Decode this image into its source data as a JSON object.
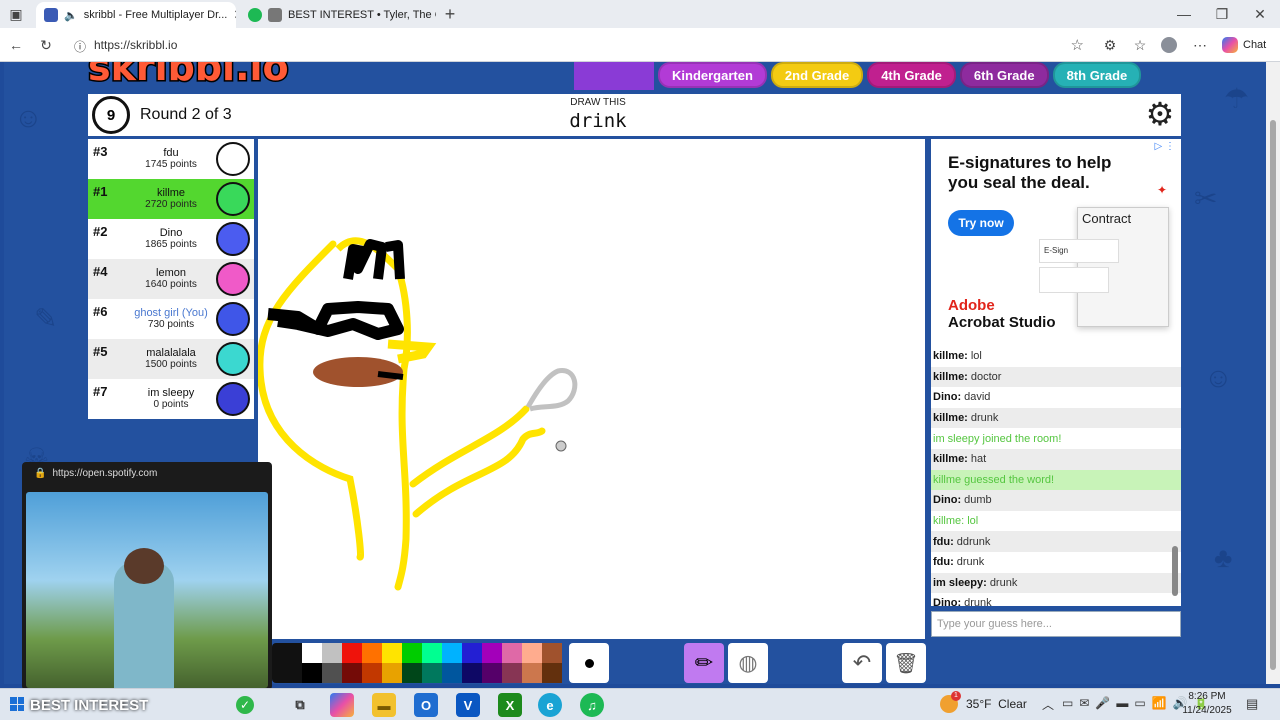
{
  "browser": {
    "tabs": [
      {
        "title": "skribbl - Free Multiplayer Dr...",
        "active": true
      },
      {
        "title": "BEST INTEREST • Tyler, The C",
        "active": false
      }
    ],
    "url": "https://skribbl.io",
    "chat_label": "Chat"
  },
  "game": {
    "grades": [
      {
        "label": "Kindergarten",
        "color": "#b23bd6"
      },
      {
        "label": "2nd Grade",
        "color": "#f3cb12"
      },
      {
        "label": "4th Grade",
        "color": "#c0208f"
      },
      {
        "label": "6th Grade",
        "color": "#8e2b9e"
      },
      {
        "label": "8th Grade",
        "color": "#26b1b5"
      }
    ],
    "timer": "9",
    "round": "Round 2 of 3",
    "draw_this_label": "DRAW THIS",
    "word": "drink",
    "players": [
      {
        "rank": "#3",
        "name": "fdu",
        "points": "1745 points",
        "color": "#ffffff"
      },
      {
        "rank": "#1",
        "name": "killme",
        "points": "2720 points",
        "color": "#39d95a"
      },
      {
        "rank": "#2",
        "name": "Dino",
        "points": "1865 points",
        "color": "#4b5cf0"
      },
      {
        "rank": "#4",
        "name": "lemon",
        "points": "1640 points",
        "color": "#f05ac8"
      },
      {
        "rank": "#6",
        "name": "ghost girl (You)",
        "points": "730 points",
        "color": "#3f56e8"
      },
      {
        "rank": "#5",
        "name": "malalalala",
        "points": "1500 points",
        "color": "#3bd8d0"
      },
      {
        "rank": "#7",
        "name": "im sleepy",
        "points": "0 points",
        "color": "#3a3fd6"
      }
    ],
    "chat": [
      {
        "who": "killme:",
        "text": "lol",
        "kind": "msg"
      },
      {
        "who": "killme:",
        "text": "doctor",
        "kind": "msg"
      },
      {
        "who": "Dino:",
        "text": "david",
        "kind": "msg"
      },
      {
        "who": "killme:",
        "text": "drunk",
        "kind": "msg"
      },
      {
        "who": "",
        "text": "im sleepy joined the room!",
        "kind": "sys"
      },
      {
        "who": "killme:",
        "text": "hat",
        "kind": "msg"
      },
      {
        "who": "",
        "text": "killme guessed the word!",
        "kind": "guess"
      },
      {
        "who": "Dino:",
        "text": "dumb",
        "kind": "msg"
      },
      {
        "who": "",
        "text": "killme: lol",
        "kind": "sys"
      },
      {
        "who": "fdu:",
        "text": "ddrunk",
        "kind": "msg"
      },
      {
        "who": "fdu:",
        "text": "drunk",
        "kind": "msg"
      },
      {
        "who": "im sleepy:",
        "text": "drunk",
        "kind": "msg"
      },
      {
        "who": "Dino:",
        "text": "drunk",
        "kind": "msg"
      }
    ],
    "guess_placeholder": "Type your guess here...",
    "palette": [
      "#ffffff",
      "#c1c1c1",
      "#ef130b",
      "#ff7100",
      "#ffe400",
      "#00cc00",
      "#00ff91",
      "#00b2ff",
      "#231fd3",
      "#a300ba",
      "#df69a7",
      "#ffac8e",
      "#a0522d",
      "#000000",
      "#505050",
      "#740b07",
      "#c23800",
      "#e8a200",
      "#004619",
      "#00785d",
      "#00569e",
      "#0e0865",
      "#550069",
      "#873554",
      "#cc774d",
      "#63300d"
    ]
  },
  "ad": {
    "headline": "E-signatures to help you seal the deal.",
    "cta": "Try now",
    "brand_line1": "Adobe",
    "brand_line2": "Acrobat Studio",
    "doc_title": "Contract",
    "esign_label": "E-Sign"
  },
  "miniplayer": {
    "url": "https://open.spotify.com",
    "title": "BEST INTEREST"
  },
  "taskbar": {
    "weather": "35°F  Clear",
    "time": "8:26 PM",
    "date": "11/24/2025",
    "notification_count": "1"
  }
}
